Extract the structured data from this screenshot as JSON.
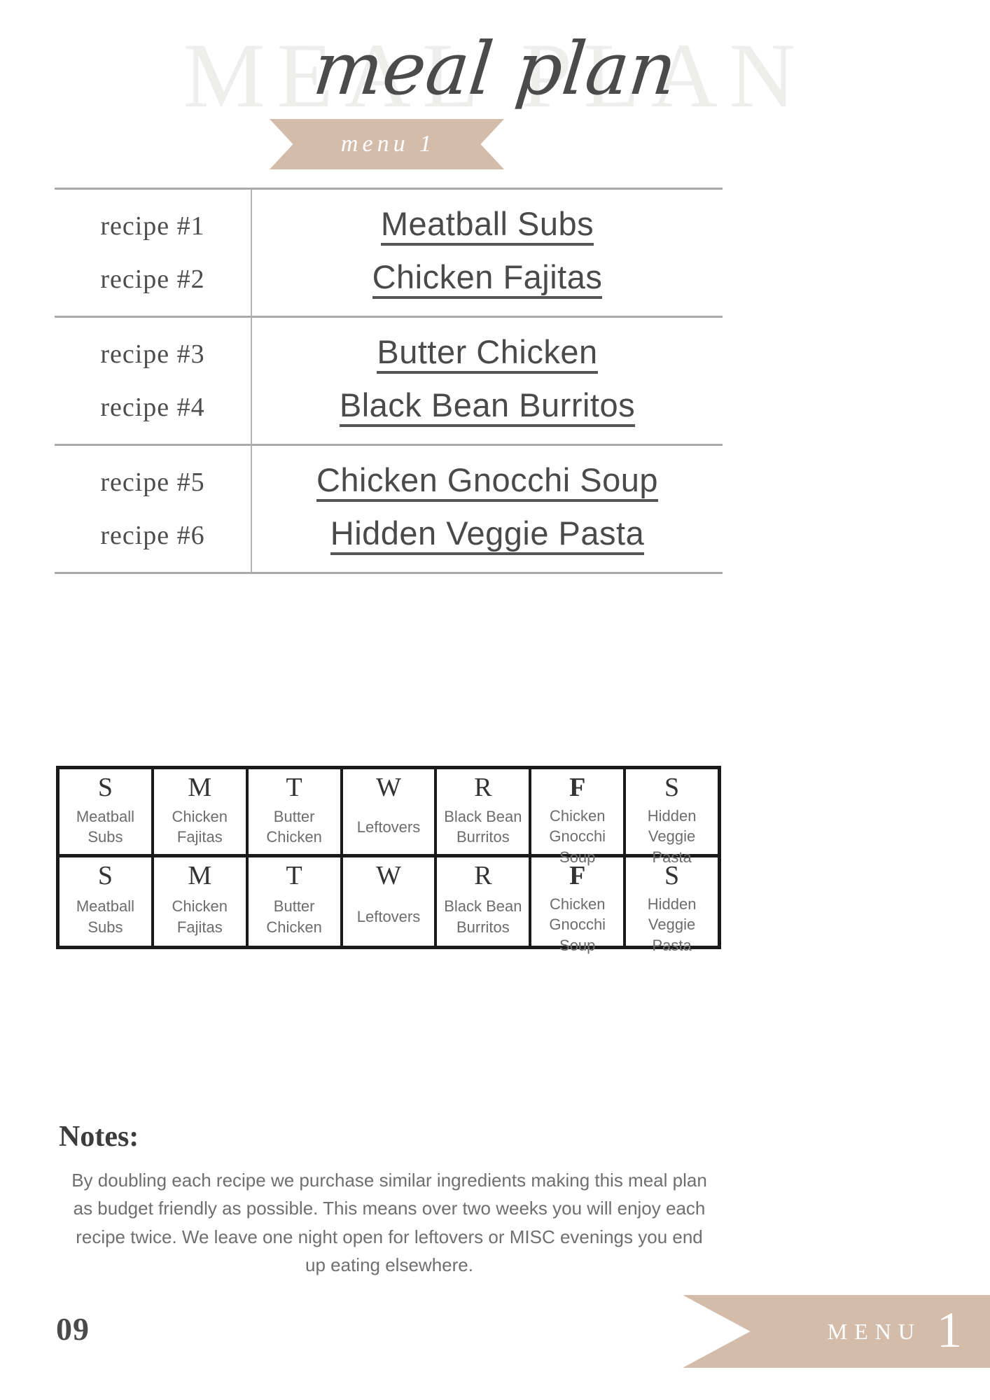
{
  "header": {
    "watermark": "MEAL PLAN",
    "script_title": "meal plan",
    "ribbon_label": "menu 1"
  },
  "recipe_table": {
    "groups": [
      {
        "labels": [
          "recipe #1",
          "recipe #2"
        ],
        "names": [
          "Meatball Subs",
          "Chicken Fajitas"
        ]
      },
      {
        "labels": [
          "recipe #3",
          "recipe #4"
        ],
        "names": [
          "Butter Chicken",
          "Black Bean Burritos"
        ]
      },
      {
        "labels": [
          "recipe #5",
          "recipe #6"
        ],
        "names": [
          "Chicken Gnocchi Soup",
          "Hidden Veggie Pasta"
        ]
      }
    ]
  },
  "calendar": {
    "days": [
      "S",
      "M",
      "T",
      "W",
      "R",
      "F",
      "S"
    ],
    "bold_days": [
      false,
      false,
      false,
      false,
      false,
      true,
      false
    ],
    "week1": [
      "Meatball\nSubs",
      "Chicken\nFajitas",
      "Butter\nChicken",
      "Leftovers",
      "Black Bean\nBurritos",
      "Chicken\nGnocchi\nSoup",
      "Hidden\nVeggie\nPasta"
    ],
    "week2": [
      "Meatball\nSubs",
      "Chicken\nFajitas",
      "Butter\nChicken",
      "Leftovers",
      "Black Bean\nBurritos",
      "Chicken\nGnocchi\nSoup",
      "Hidden\nVeggie\nPasta"
    ]
  },
  "notes": {
    "title": "Notes:",
    "body": "By doubling each recipe we purchase similar ingredients making this meal plan as budget friendly as possible. This means over two weeks you will enjoy each recipe twice. We leave one night open for leftovers or MISC evenings you end up eating elsewhere."
  },
  "footer": {
    "page_number": "09",
    "ribbon_label": "MENU",
    "ribbon_number": "1"
  },
  "colors": {
    "ribbon": "#d4bcab",
    "watermark": "#eeeeed",
    "text_dark": "#4b4b4b",
    "text_muted": "#6f6f6f",
    "rule": "#aaaaaa",
    "grid_border": "#1a1a1a"
  }
}
